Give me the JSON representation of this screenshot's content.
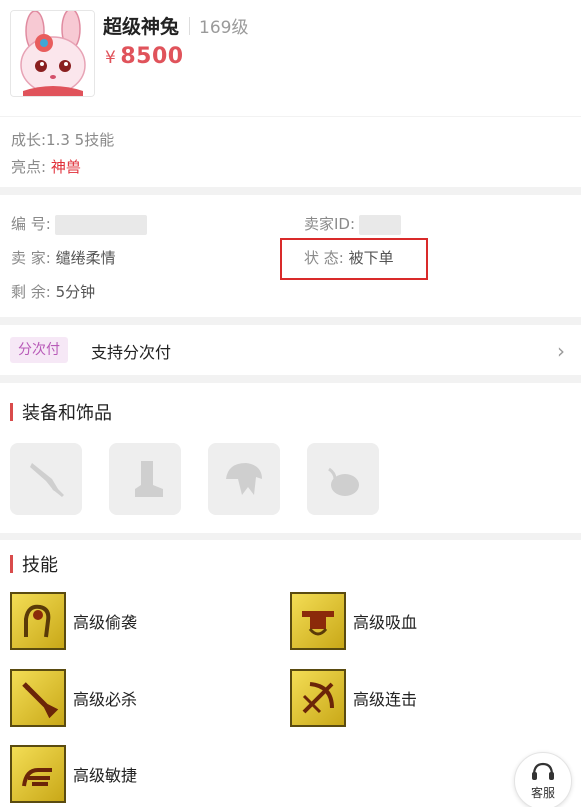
{
  "pet": {
    "name": "超级神兔",
    "level": "169级",
    "price_symbol": "¥",
    "price": "8500"
  },
  "stats": {
    "growth": "成长:1.3 5技能",
    "highlight_label": "亮点:",
    "highlight_value": "神兽"
  },
  "info": {
    "serial_label": "编 号:",
    "seller_id_label": "卖家ID:",
    "seller_label": "卖 家:",
    "seller_value": "缱绻柔情",
    "status_label": "状 态:",
    "status_value": "被下单",
    "remaining_label": "剩 余:",
    "remaining_value": "5分钟"
  },
  "installment": {
    "tag": "分次付",
    "text": "支持分次付"
  },
  "equipment": {
    "title": "装备和饰品",
    "slots": [
      "weapon-icon",
      "boot-icon",
      "helmet-icon",
      "accessory-icon"
    ]
  },
  "skills": {
    "title": "技能",
    "items": [
      {
        "name": "高级偷袭",
        "icon": "sneak-attack-icon"
      },
      {
        "name": "高级吸血",
        "icon": "vampire-icon"
      },
      {
        "name": "高级必杀",
        "icon": "critical-icon"
      },
      {
        "name": "高级连击",
        "icon": "combo-icon"
      },
      {
        "name": "高级敏捷",
        "icon": "agility-icon"
      }
    ]
  },
  "service": {
    "label": "客服"
  },
  "colors": {
    "price": "#e0535b",
    "highlight": "#e0303a",
    "status_box": "#d92a2a",
    "section_bar": "#d94b4b",
    "tag_bg": "#f6e8f6",
    "tag_text": "#b85ab8"
  }
}
